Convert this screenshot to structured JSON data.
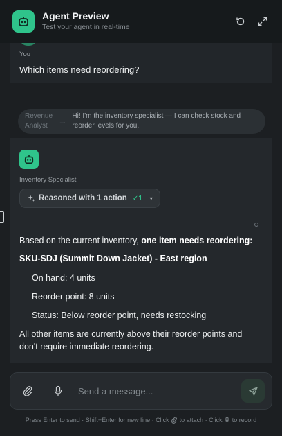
{
  "header": {
    "title": "Agent Preview",
    "subtitle": "Test your agent in real-time",
    "icon": "robot-icon",
    "actions": [
      "refresh-icon",
      "expand-icon"
    ]
  },
  "conversation": {
    "user_label": "You",
    "user_message": "Which items need reordering?",
    "handoff": {
      "from": "Revenue Analyst",
      "arrow": "→",
      "message": "Hi! I'm the inventory specialist — I can check stock and reorder levels for you."
    },
    "agent": {
      "name": "Inventory Specialist",
      "reasoning_label": "Reasoned with 1 action",
      "reasoning_count": "✓1",
      "caret": "▾",
      "intro_plain": "Based on the current inventory, ",
      "intro_bold": "one item needs reordering:",
      "item_heading": "SKU-SDJ (Summit Down Jacket) - East region",
      "details": [
        "On hand: 4 units",
        "Reorder point: 8 units",
        "Status: Below reorder point, needs restocking"
      ],
      "closing": "All other items are currently above their reorder points and don't require immediate reordering."
    }
  },
  "composer": {
    "placeholder": "Send a message...",
    "attach_icon": "paperclip-icon",
    "mic_icon": "microphone-icon",
    "send_icon": "send-icon"
  },
  "hint": {
    "part1": "Press Enter to send · Shift+Enter for new line · Click",
    "part2": "to attach · Click",
    "part3": "to record"
  },
  "colors": {
    "accent": "#2fc48b",
    "background": "#1c1f22",
    "header": "#161a1c"
  }
}
